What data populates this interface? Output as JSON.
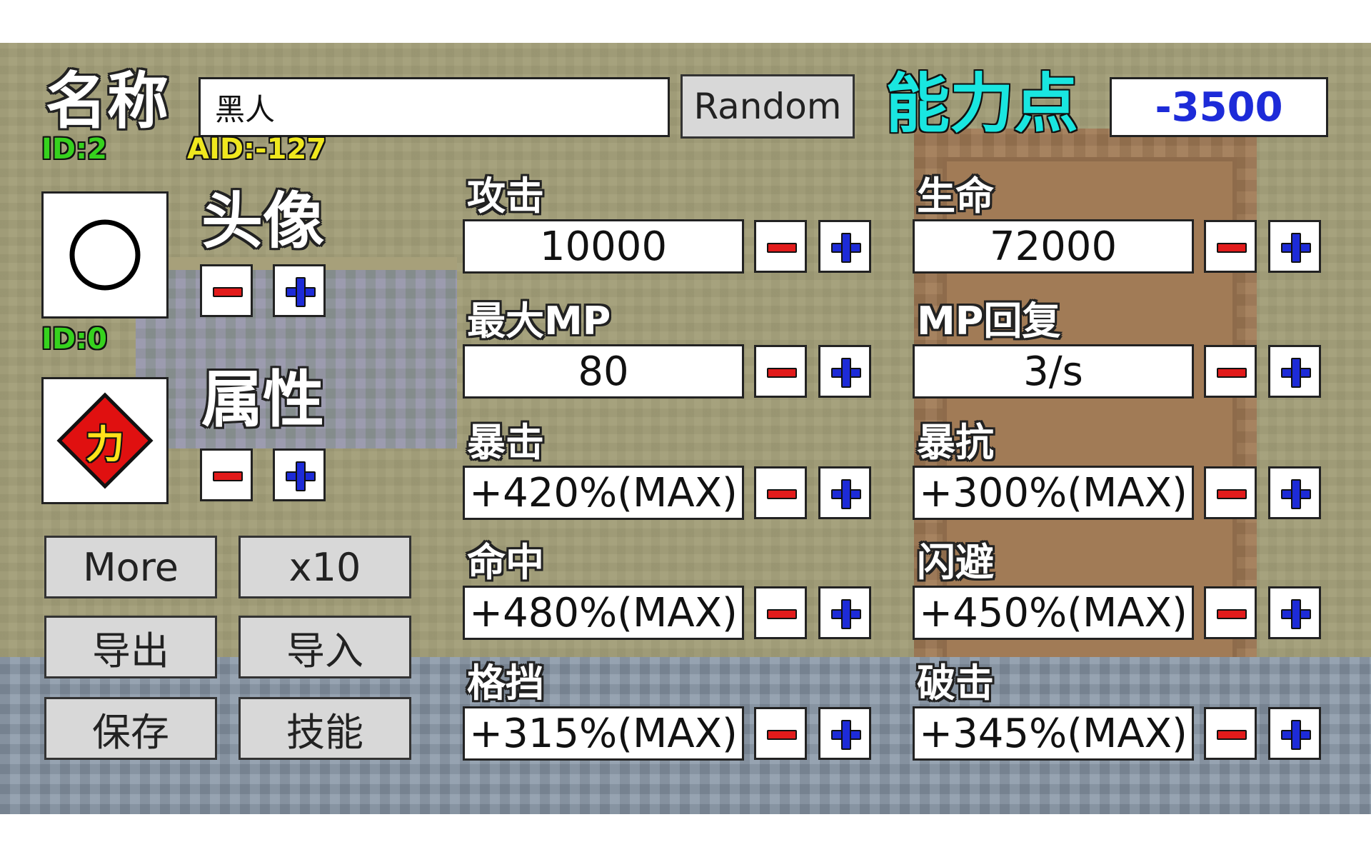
{
  "header": {
    "name_label": "名称",
    "name_value": "黑人",
    "id_text": "ID:2",
    "aid_text": "AID:-127",
    "random_label": "Random",
    "points_label": "能力点",
    "points_value": "-3500"
  },
  "avatar": {
    "label": "头像",
    "id_text": "ID:0"
  },
  "attribute": {
    "label": "属性",
    "glyph": "力"
  },
  "buttons": {
    "more": "More",
    "x10": "x10",
    "export": "导出",
    "import": "导入",
    "save": "保存",
    "skill": "技能"
  },
  "stats": [
    {
      "label": "攻击",
      "value": "10000"
    },
    {
      "label": "生命",
      "value": "72000"
    },
    {
      "label": "最大MP",
      "value": "80"
    },
    {
      "label": "MP回复",
      "value": "3/s"
    },
    {
      "label": "暴击",
      "value": "+420%(MAX)"
    },
    {
      "label": "暴抗",
      "value": "+300%(MAX)"
    },
    {
      "label": "命中",
      "value": "+480%(MAX)"
    },
    {
      "label": "闪避",
      "value": "+450%(MAX)"
    },
    {
      "label": "格挡",
      "value": "+315%(MAX)"
    },
    {
      "label": "破击",
      "value": "+345%(MAX)"
    }
  ],
  "colors": {
    "points_label": "#19e6e0",
    "points_value": "#1d2bd8",
    "id_green": "#36d21e",
    "aid_yellow": "#f0e81e",
    "minus_red": "#e21b1b",
    "plus_blue": "#1d2bd8",
    "attribute_diamond": "#e01010"
  },
  "icons": {
    "avatar": "circle-outline-icon",
    "attribute": "red-diamond-icon",
    "minus": "minus-icon",
    "plus": "plus-icon"
  }
}
